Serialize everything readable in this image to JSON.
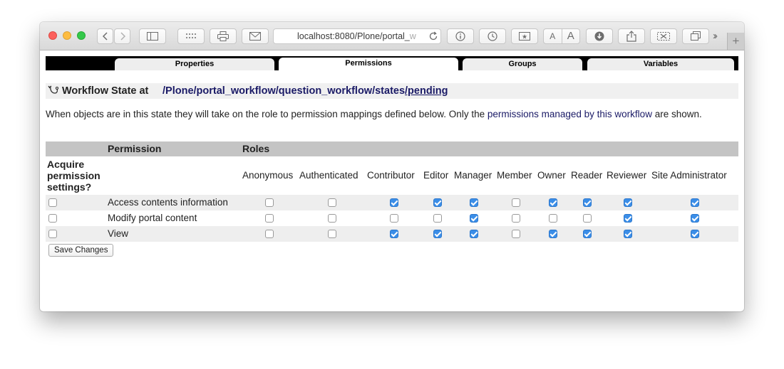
{
  "browser": {
    "address_text": "localhost:8080/Plone/portal_",
    "address_fade": "w"
  },
  "tabs": [
    {
      "label": "Properties",
      "active": false
    },
    {
      "label": "Permissions",
      "active": true
    },
    {
      "label": "Groups",
      "active": false
    },
    {
      "label": "Variables",
      "active": false
    }
  ],
  "title": {
    "label": "Workflow State at",
    "crumbs": [
      "/Plone",
      "/portal_workflow",
      "/question_workflow",
      "/states",
      "/pending"
    ]
  },
  "description": {
    "before": "When objects are in this state they will take on the role to permission mappings defined below. Only the ",
    "link": "permissions managed by this workflow",
    "after": " are shown."
  },
  "table": {
    "header_permission": "Permission",
    "header_roles": "Roles",
    "acquire_label_1": "Acquire",
    "acquire_label_2": "permission",
    "acquire_label_3": "settings?",
    "roles": [
      "Anonymous",
      "Authenticated",
      "Contributor",
      "Editor",
      "Manager",
      "Member",
      "Owner",
      "Reader",
      "Reviewer",
      "Site Administrator"
    ],
    "rows": [
      {
        "name": "Access contents information",
        "acquire": false,
        "checks": [
          false,
          false,
          true,
          true,
          true,
          false,
          true,
          true,
          true,
          true
        ]
      },
      {
        "name": "Modify portal content",
        "acquire": false,
        "checks": [
          false,
          false,
          false,
          false,
          true,
          false,
          false,
          false,
          true,
          true
        ]
      },
      {
        "name": "View",
        "acquire": false,
        "checks": [
          false,
          false,
          true,
          true,
          true,
          false,
          true,
          true,
          true,
          true
        ]
      }
    ]
  },
  "save_button": "Save Changes"
}
